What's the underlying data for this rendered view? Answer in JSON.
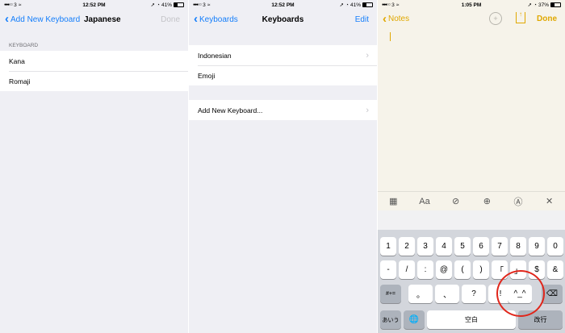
{
  "panel1": {
    "status": {
      "carrier": "3",
      "time": "12:52 PM",
      "battery": "41%",
      "battery_level": 0.41
    },
    "nav": {
      "back_label": "Add New Keyboard",
      "title": "Japanese",
      "right": "Done"
    },
    "section_header": "KEYBOARD",
    "rows": [
      "Kana",
      "Romaji"
    ]
  },
  "panel2": {
    "status": {
      "carrier": "3",
      "time": "12:52 PM",
      "battery": "41%",
      "battery_level": 0.41
    },
    "nav": {
      "back_label": "Keyboards",
      "title": "Keyboards",
      "right": "Edit"
    },
    "keyboards": [
      "Indonesian",
      "Emoji"
    ],
    "add_row": "Add New Keyboard..."
  },
  "panel3": {
    "status": {
      "carrier": "3",
      "time": "1:05 PM",
      "battery": "37%",
      "battery_level": 0.37
    },
    "nav": {
      "back_label": "Notes",
      "done": "Done"
    },
    "toolbar_icons": [
      "table-icon",
      "text-format-icon",
      "checklist-icon",
      "add-icon",
      "markup-icon",
      "close-icon"
    ],
    "toolbar_glyphs": [
      "▦",
      "Aa",
      "⊘",
      "⊕",
      "Ⓐ",
      "✕"
    ],
    "keyboard": {
      "row1": [
        "1",
        "2",
        "3",
        "4",
        "5",
        "6",
        "7",
        "8",
        "9",
        "0"
      ],
      "row2": [
        "-",
        "/",
        ":",
        "@",
        "(",
        ")",
        "「",
        "」",
        "$",
        "&"
      ],
      "row3": [
        "#+=",
        "。",
        "、",
        "?",
        "!",
        "^_^",
        "⌫"
      ],
      "row4": [
        "あいう",
        "🌐",
        "空白",
        "改行"
      ]
    }
  },
  "colors": {
    "ios_blue": "#147efb",
    "notes_yellow": "#e0a800",
    "highlight_red": "#e0261b"
  }
}
